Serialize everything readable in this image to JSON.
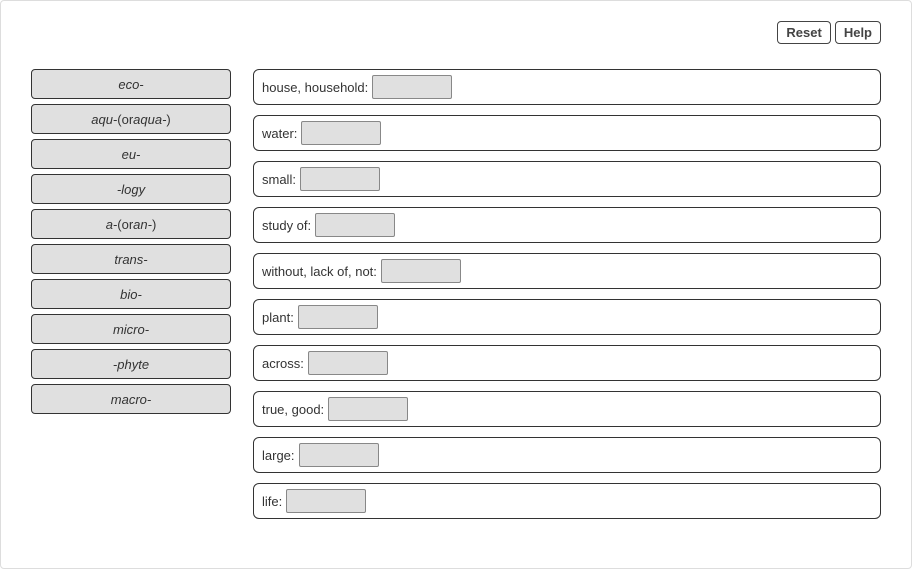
{
  "toolbar": {
    "reset_label": "Reset",
    "help_label": "Help"
  },
  "draggables": [
    {
      "html": "eco-"
    },
    {
      "html": "aqu- <span class='nonital'>(or</span> aqua-<span class='nonital'>)</span>"
    },
    {
      "html": "eu-"
    },
    {
      "html": "-logy"
    },
    {
      "html": "a- <span class='nonital'>(or</span> an-<span class='nonital'>)</span>"
    },
    {
      "html": "trans-"
    },
    {
      "html": "bio-"
    },
    {
      "html": "micro-"
    },
    {
      "html": "-phyte"
    },
    {
      "html": "macro-"
    }
  ],
  "targets": [
    {
      "label": "house, household:"
    },
    {
      "label": "water:"
    },
    {
      "label": "small:"
    },
    {
      "label": "study of:"
    },
    {
      "label": "without, lack of, not:"
    },
    {
      "label": "plant:"
    },
    {
      "label": "across:"
    },
    {
      "label": "true, good:"
    },
    {
      "label": "large:"
    },
    {
      "label": "life:"
    }
  ]
}
